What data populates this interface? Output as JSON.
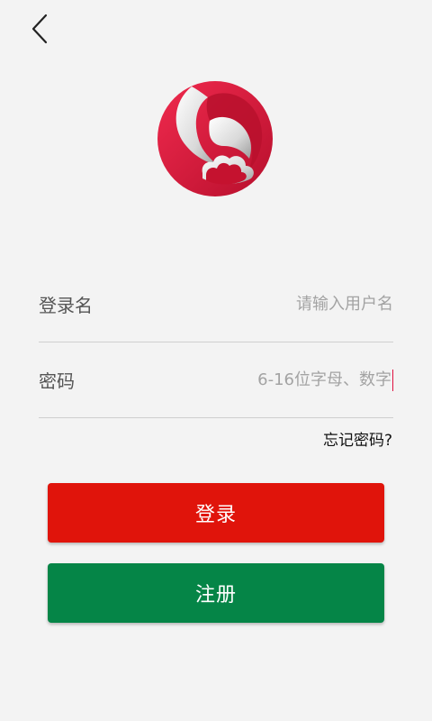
{
  "colors": {
    "background": "#f3f3f3",
    "login_button": "#e0140b",
    "register_button": "#058547",
    "logo_primary": "#d6163c",
    "divider": "#cfcfcf"
  },
  "header": {
    "back_icon": "chevron-left-icon"
  },
  "logo": {
    "icon": "brand-logo-icon"
  },
  "form": {
    "username_label": "登录名",
    "username_placeholder": "请输入用户名",
    "password_label": "密码",
    "password_placeholder": "6-16位字母、数字"
  },
  "links": {
    "forgot_password": "忘记密码?"
  },
  "buttons": {
    "login": "登录",
    "register": "注册"
  }
}
